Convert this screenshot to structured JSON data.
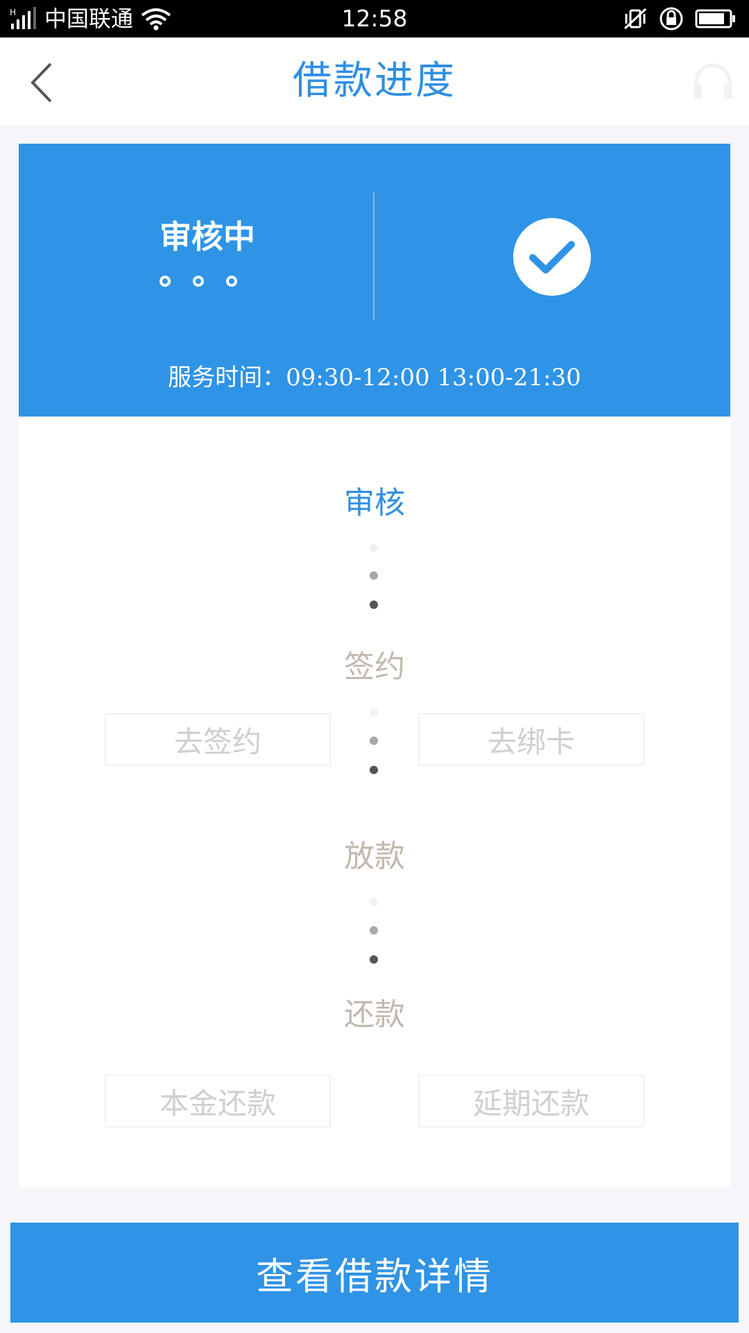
{
  "status_bar": {
    "carrier": "中国联通",
    "time": "12:58"
  },
  "nav": {
    "title": "借款进度"
  },
  "status_card": {
    "status": "审核中",
    "service_time": "服务时间：09:30-12:00 13:00-21:30"
  },
  "steps": [
    {
      "label": "审核"
    },
    {
      "label": "签约"
    },
    {
      "label": "放款"
    },
    {
      "label": "还款"
    }
  ],
  "actions": {
    "sign": "去签约",
    "bind_card": "去绑卡",
    "principal_repay": "本金还款",
    "extend_repay": "延期还款"
  },
  "bottom_button": {
    "label": "查看借款详情"
  },
  "colors": {
    "primary": "#2f93e6",
    "title": "#2f8fe3",
    "inactive_step": "#c2b9ae"
  }
}
